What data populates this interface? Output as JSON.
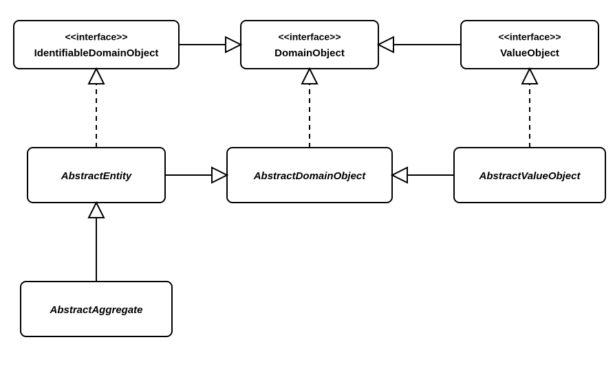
{
  "diagram": {
    "type": "uml-class",
    "nodes": {
      "identifiableDomainObject": {
        "stereotype": "<<interface>>",
        "name": "IdentifiableDomainObject",
        "italic": false
      },
      "domainObject": {
        "stereotype": "<<interface>>",
        "name": "DomainObject",
        "italic": false
      },
      "valueObject": {
        "stereotype": "<<interface>>",
        "name": "ValueObject",
        "italic": false
      },
      "abstractEntity": {
        "stereotype": "",
        "name": "AbstractEntity",
        "italic": true
      },
      "abstractDomainObject": {
        "stereotype": "",
        "name": "AbstractDomainObject",
        "italic": true
      },
      "abstractValueObject": {
        "stereotype": "",
        "name": "AbstractValueObject",
        "italic": true
      },
      "abstractAggregate": {
        "stereotype": "",
        "name": "AbstractAggregate",
        "italic": true
      }
    },
    "edges": [
      {
        "from": "identifiableDomainObject",
        "to": "domainObject",
        "style": "solid",
        "kind": "generalization"
      },
      {
        "from": "valueObject",
        "to": "domainObject",
        "style": "solid",
        "kind": "generalization"
      },
      {
        "from": "abstractEntity",
        "to": "identifiableDomainObject",
        "style": "dashed",
        "kind": "realization"
      },
      {
        "from": "abstractDomainObject",
        "to": "domainObject",
        "style": "dashed",
        "kind": "realization"
      },
      {
        "from": "abstractValueObject",
        "to": "valueObject",
        "style": "dashed",
        "kind": "realization"
      },
      {
        "from": "abstractEntity",
        "to": "abstractDomainObject",
        "style": "solid",
        "kind": "generalization"
      },
      {
        "from": "abstractValueObject",
        "to": "abstractDomainObject",
        "style": "solid",
        "kind": "generalization"
      },
      {
        "from": "abstractAggregate",
        "to": "abstractEntity",
        "style": "solid",
        "kind": "generalization"
      }
    ]
  }
}
